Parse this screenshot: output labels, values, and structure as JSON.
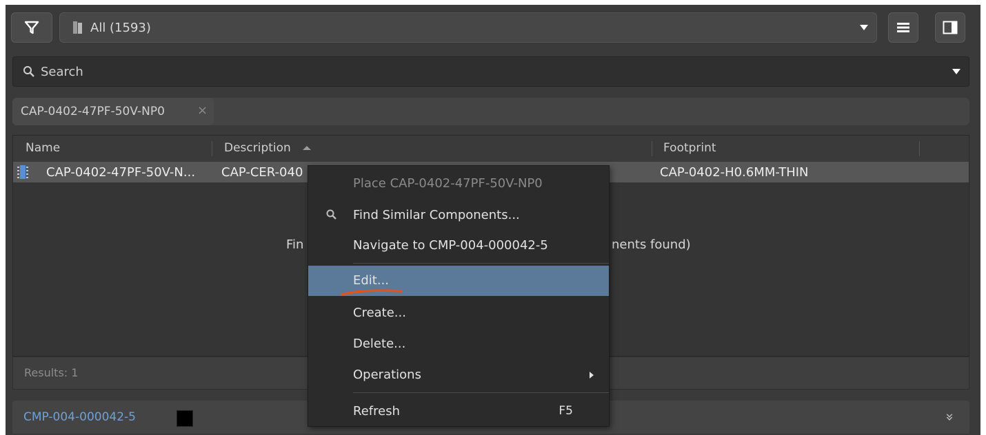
{
  "toolbar": {
    "library_filter_label": "All  (1593)",
    "icons": {
      "filter": "filter-icon",
      "library": "library-icon",
      "list_view": "list-view-icon",
      "panel_view": "panel-view-icon",
      "dropdown": "chevron-down-icon"
    }
  },
  "search": {
    "placeholder": "Search"
  },
  "filter_chip": {
    "label": "CAP-0402-47PF-50V-NP0",
    "remove": "×"
  },
  "grid": {
    "columns": [
      {
        "label": "Name"
      },
      {
        "label": "Description",
        "sorted": "ascending"
      },
      {
        "label": "Footprint"
      }
    ],
    "rows": [
      {
        "name": "CAP-0402-47PF-50V-N...",
        "description": "CAP-CER-040",
        "footprint": "CAP-0402-H0.6MM-THIN"
      }
    ],
    "empty_message_left": "Fin",
    "empty_message_right": "nents found)"
  },
  "results": {
    "label": "Results: 1"
  },
  "detail": {
    "component_id": "CMP-004-000042-5",
    "expand": "»"
  },
  "context_menu": {
    "items": [
      {
        "label": "Place CAP-0402-47PF-50V-NP0",
        "disabled": true
      },
      {
        "label": "Find Similar Components...",
        "icon": "search-icon"
      },
      {
        "label": "Navigate to CMP-004-000042-5"
      },
      {
        "label": "Edit...",
        "highlighted": true
      },
      {
        "label": "Create..."
      },
      {
        "label": "Delete..."
      },
      {
        "label": "Operations",
        "submenu": true
      },
      {
        "label": "Refresh",
        "shortcut": "F5"
      }
    ]
  },
  "colors": {
    "highlight": "#5b7a99",
    "link": "#6fa0d8",
    "annotation": "#e2531e"
  }
}
